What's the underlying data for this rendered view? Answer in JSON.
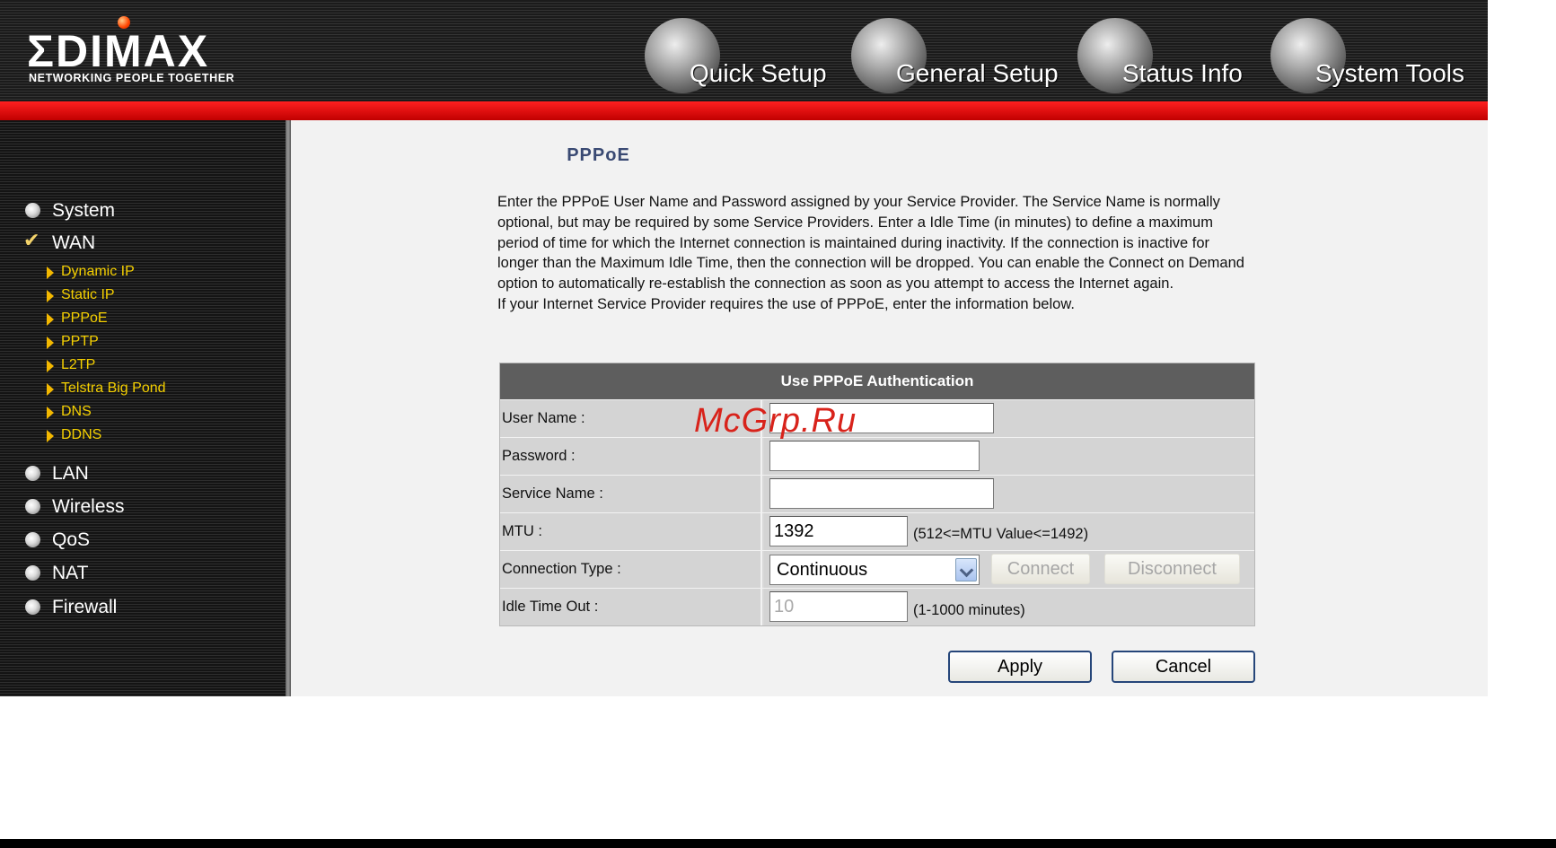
{
  "brand": {
    "logo": "ΣDIMAX",
    "tagline": "NETWORKING PEOPLE TOGETHER"
  },
  "topnav": [
    {
      "label": "Quick Setup",
      "icon": "globe-icon"
    },
    {
      "label": "General Setup",
      "icon": "keyboard-icon"
    },
    {
      "label": "Status Info",
      "icon": "network-plug-icon"
    },
    {
      "label": "System Tools",
      "icon": "tools-icon"
    }
  ],
  "sidebar": {
    "items": [
      {
        "label": "System"
      },
      {
        "label": "WAN",
        "selected": true
      },
      {
        "label": "LAN"
      },
      {
        "label": "Wireless"
      },
      {
        "label": "QoS"
      },
      {
        "label": "NAT"
      },
      {
        "label": "Firewall"
      }
    ],
    "wan_subitems": [
      "Dynamic IP",
      "Static IP",
      "PPPoE",
      "PPTP",
      "L2TP",
      "Telstra Big Pond",
      "DNS",
      "DDNS"
    ]
  },
  "main": {
    "title": "PPPoE",
    "description": "Enter the PPPoE User Name and Password assigned by your Service Provider. The Service Name is normally optional, but may be required by some Service Providers. Enter a Idle Time (in minutes) to define a maximum period of time for which the Internet connection is maintained during inactivity. If the connection is inactive for longer than the Maximum Idle Time, then the connection will be dropped. You can enable the Connect on Demand option to automatically re-establish the connection as soon as you attempt to access the Internet again.",
    "description2": "If your Internet Service Provider requires the use of PPPoE, enter the information below."
  },
  "form": {
    "header": "Use PPPoE Authentication",
    "username_label": "User Name :",
    "username_value": "",
    "password_label": "Password :",
    "password_value": "",
    "service_label": "Service Name :",
    "service_value": "",
    "mtu_label": "MTU :",
    "mtu_value": "1392",
    "mtu_hint": "(512<=MTU Value<=1492)",
    "conn_type_label": "Connection Type :",
    "conn_type_value": "Continuous",
    "connect_label": "Connect",
    "disconnect_label": "Disconnect",
    "idle_label": "Idle Time Out :",
    "idle_value": "10",
    "idle_hint": "(1-1000 minutes)"
  },
  "buttons": {
    "apply": "Apply",
    "cancel": "Cancel"
  },
  "watermark": "McGrp.Ru"
}
